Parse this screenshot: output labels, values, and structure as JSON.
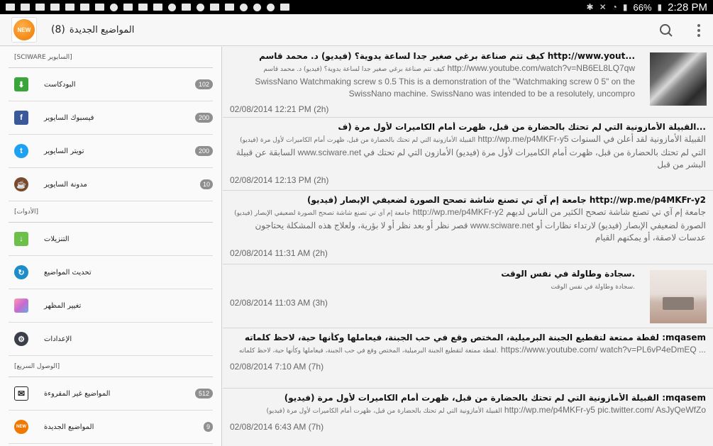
{
  "status_bar": {
    "battery": "66%",
    "time": "2:28 PM"
  },
  "app": {
    "title": "المواضيع الجديدة",
    "count": "(8)",
    "logo_text": "NEW"
  },
  "sidebar": {
    "sections": [
      {
        "label": "[SCIWARE السايوير]"
      },
      {
        "label": "[الأدوات]"
      },
      {
        "label": "[الوصول السريع]"
      }
    ],
    "group1": [
      {
        "label": "البودكاست",
        "badge": "102",
        "icon": "podcast-icon",
        "color": "#3aa53a"
      },
      {
        "label": "فيسبوك السايوير",
        "badge": "200",
        "icon": "facebook-icon",
        "color": "#3b5998"
      },
      {
        "label": "تويتر السايوير",
        "badge": "200",
        "icon": "twitter-icon",
        "color": "#1da1f2"
      },
      {
        "label": "مدونة السايوير",
        "badge": "10",
        "icon": "coffee-cup-icon",
        "color": "#7a4a2a"
      }
    ],
    "group2": [
      {
        "label": "التنزيلات",
        "icon": "download-arrow-icon",
        "color": "#6cc04a"
      },
      {
        "label": "تحديث المواضيع",
        "icon": "refresh-icon",
        "color": "#1e8cc8"
      },
      {
        "label": "تغيير المظهر",
        "icon": "palette-icon",
        "color": "#c86ad2"
      },
      {
        "label": "الإعدادات",
        "icon": "settings-gear-icon",
        "color": "#3a3f4a"
      }
    ],
    "group3": [
      {
        "label": "المواضيع غير المقروءة",
        "badge": "512",
        "icon": "envelope-icon",
        "color": "#222222"
      },
      {
        "label": "المواضيع الجديدة",
        "badge": "9",
        "icon": "new-badge-icon",
        "color": "#f07800"
      }
    ]
  },
  "posts": [
    {
      "title": "كيف تتم صناعة برغي صغير جدا لساعة يدوية؟ (فيديو) د. محمد قاسم http://www.yout...",
      "body_ar": "كيف تتم صناعة برغي صغير جدا لساعة يدوية؟ (فيديو) د. محمد قاسم",
      "body_en": "http://www.youtube.com/watch?v=NB6EL8LQ7qw SwissNano Watchmaking screw s 0.5 This is a demonstration of the \"Watchmaking screw 0 5\" on the SwissNano machine. SwissNano was intended to be a resolutely, uncompro",
      "date": "02/08/2014 12:21 PM (2h)",
      "thumb": "watch"
    },
    {
      "title": "القبيلة الأمازونية التي لم تحتك بالحضارة من قبل، ظهرت أمام الكاميرات لأول مرة (ف...",
      "body_ar": "القبيلة الأمازونية التي لم تحتك بالحضارة من قبل، ظهرت أمام الكاميرات لأول مرة (فيديو)",
      "body_en": "http://wp.me/p4MKFr-y5 القبيلة الأمازونية لقد أعلن في السنوات السابقة عن قبيلة www.sciware.net التي لم تحتك بالحضارة من قبل، ظهرت أمام الكاميرات لأول مرة (فيديو) الأمازون التي لم تحتك في البشر من قبل",
      "date": "02/08/2014 12:13 PM (2h)"
    },
    {
      "title": "جامعة إم آي تي تصنع شاشة تصحح الصورة لضعيفي الإبصار (فيديو) http://wp.me/p4MKFr-y2",
      "body_ar": "جامعة إم آي تي تصنع شاشة تصحح الصورة لضعيفي الإبصار (فيديو)",
      "body_en": "http://wp.me/p4MKFr-y2 جامعة إم آي تي تصنع شاشة تصحح الكثير من الناس لديهم قصر نظر أو بعد نظر أو لا بؤرية، ولعلاج هذه المشكلة يحتاجون www.sciware.net الصورة لضعيفي الإبصار (فيديو) لارتداء نظارات أو عدسات لاصقة، أو يمكنهم القيام",
      "date": "02/08/2014 11:31 AM (2h)"
    },
    {
      "title": "سجادة وطاولة في نفس الوقت.",
      "body_ar": "سجادة وطاولة في نفس الوقت.",
      "body_en": "",
      "date": "02/08/2014 11:03 AM (3h)",
      "thumb": "room"
    },
    {
      "title": "لقطة ممتعة لتقطيع الجبنة البرميلية، المختص وقع في حب الجبنة، فيعاملها وكأنها حية، لاحظ كلماته :mqasem",
      "body_ar": "لقطة ممتعة لتقطيع الجبنة البرميلية، المختص وقع في حب الجبنة، فيعاملها وكأنها حية، لاحظ كلماته.",
      "body_en": "https://www.youtube.com/ watch?v=PL6vP4eDmEQ ...",
      "date": "02/08/2014 7:10 AM (7h)"
    },
    {
      "title": "القبيلة الأمازونية التي لم تحتك بالحضارة من قبل، ظهرت أمام الكاميرات لأول مرة (فيديو) :mqasem",
      "body_ar": "القبيلة الأمازونية التي لم تحتك بالحضارة من قبل، ظهرت أمام الكاميرات لأول مرة (فيديو)",
      "body_en": "http://wp.me/p4MKFr-y5 pic.twitter.com/ AsJyQeWfZo",
      "date": "02/08/2014 6:43 AM (7h)"
    }
  ]
}
